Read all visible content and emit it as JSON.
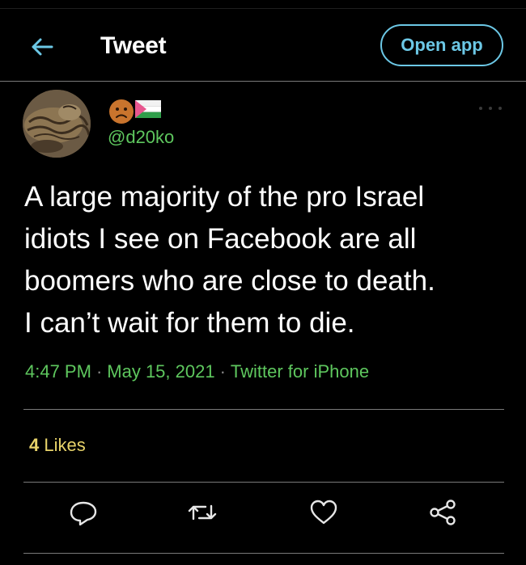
{
  "header": {
    "title": "Tweet",
    "open_app_label": "Open app",
    "back_icon": "arrow-left-icon"
  },
  "tweet": {
    "handle": "@d20ko",
    "name_emoji": [
      "frowning-face-emoji",
      "palestine-flag-emoji"
    ],
    "text_lines": [
      "A large majority of the pro Israel",
      "idiots I see on Facebook are all",
      "boomers who are close to death.",
      "I can’t wait for them to die."
    ],
    "time": "4:47 PM",
    "date": "May 15, 2021",
    "source": "Twitter for iPhone",
    "separator": "·"
  },
  "stats": {
    "likes_count": "4",
    "likes_label": "Likes"
  },
  "actions": [
    "reply-icon",
    "retweet-icon",
    "like-icon",
    "share-icon"
  ],
  "colors": {
    "background": "#000000",
    "accent": "#6cc8e6",
    "meta_green": "#5ec75e",
    "likes_yellow": "#e8d36a"
  }
}
